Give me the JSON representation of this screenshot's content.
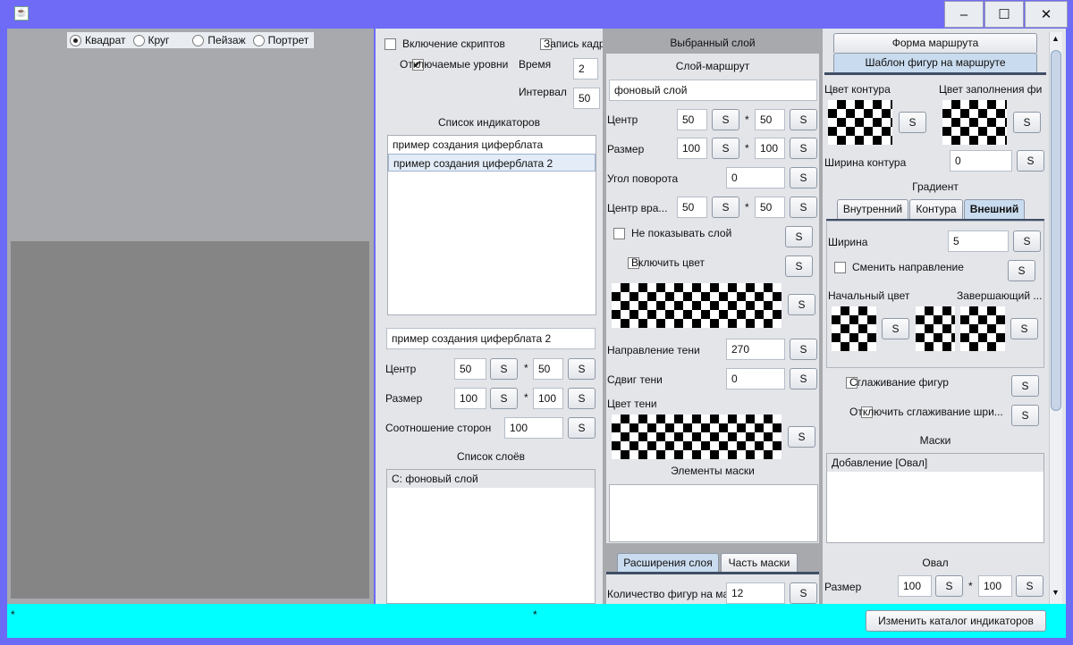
{
  "window": {
    "minimize": "–",
    "maximize": "☐",
    "close": "✕"
  },
  "shape_options": [
    {
      "label": "Квадрат",
      "checked": true
    },
    {
      "label": "Круг",
      "checked": false
    },
    {
      "label": "Пейзаж",
      "checked": false
    },
    {
      "label": "Портрет",
      "checked": false
    }
  ],
  "col1": {
    "scripts_label": "Включение скриптов",
    "record_label": "Запись кадр",
    "levels_label": "Отключаемые уровни",
    "time_label": "Время",
    "time_value": "2",
    "interval_label": "Интервал",
    "interval_value": "50",
    "indicators_title": "Список индикаторов",
    "indicators": [
      "пример создания циферблата",
      "пример создания циферблата 2"
    ],
    "name_value": "пример создания циферблата 2",
    "center_label": "Центр",
    "center_x": "50",
    "center_y": "50",
    "size_label": "Размер",
    "size_w": "100",
    "size_h": "100",
    "aspect_label": "Соотношение сторон",
    "aspect_value": "100",
    "layers_title": "Список слоёв",
    "layers": [
      "С: фоновый слой"
    ]
  },
  "col2": {
    "header": "Выбранный слой",
    "route_title": "Слой-маршрут",
    "layer_name": "фоновый слой",
    "center_label": "Центр",
    "center_x": "50",
    "center_y": "50",
    "size_label": "Размер",
    "size_w": "100",
    "size_h": "100",
    "rotation_label": "Угол поворота",
    "rotation_value": "0",
    "rot_center_label": "Центр вра...",
    "rot_center_x": "50",
    "rot_center_y": "50",
    "hide_label": "Не показывать слой",
    "color_label": "Включить цвет",
    "shadow_dir_label": "Направление тени",
    "shadow_dir_value": "270",
    "shadow_shift_label": "Сдвиг тени",
    "shadow_shift_value": "0",
    "shadow_color_label": "Цвет тени",
    "mask_elements_label": "Элементы маски",
    "tabs": [
      "Расширения слоя",
      "Часть маски"
    ],
    "count_label": "Количество фигур на ма",
    "count_value": "12"
  },
  "col3": {
    "tabs_top": [
      "Форма маршрута",
      "Шаблон фигур на маршруте"
    ],
    "outline_color_label": "Цвет контура",
    "fill_color_label": "Цвет заполнения фи",
    "outline_width_label": "Ширина контура",
    "outline_width_value": "0",
    "gradient_label": "Градиент",
    "grad_tabs": [
      "Внутренний",
      "Контура",
      "Внешний"
    ],
    "width_label": "Ширина",
    "width_value": "5",
    "reverse_label": "Сменить направление",
    "start_color_label": "Начальный цвет",
    "end_color_label": "Завершающий ...",
    "smooth_label": "Сглаживание фигур",
    "no_smooth_label": "Отключить сглаживание шри...",
    "masks_label": "Маски",
    "masks": [
      "Добавление [Овал]"
    ],
    "oval_label": "Овал",
    "size_label": "Размер",
    "size_w": "100",
    "size_h": "100"
  },
  "s_label": "S",
  "mult": "*",
  "status": {
    "left": "*",
    "center": "*",
    "catalog_button": "Изменить каталог индикаторов"
  },
  "colors": {
    "titlebar": "#6F6BF7",
    "statusbar": "#00FFFF",
    "panel": "#E3E5E9"
  }
}
